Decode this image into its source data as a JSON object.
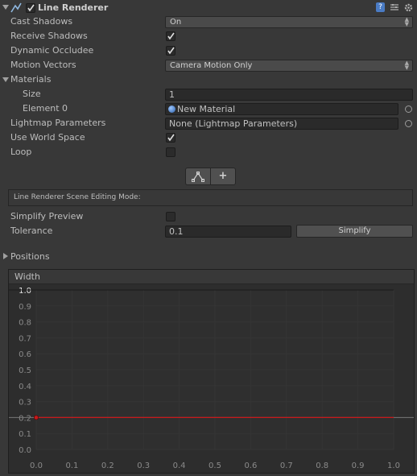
{
  "header": {
    "title": "Line Renderer",
    "icons": [
      "line-renderer-icon",
      "enable-checkbox",
      "help-icon",
      "preset-icon",
      "gear-icon"
    ]
  },
  "properties": {
    "cast_shadows": {
      "label": "Cast Shadows",
      "value": "On"
    },
    "receive_shadows": {
      "label": "Receive Shadows",
      "checked": true
    },
    "dynamic_occludee": {
      "label": "Dynamic Occludee",
      "checked": true
    },
    "motion_vectors": {
      "label": "Motion Vectors",
      "value": "Camera Motion Only"
    },
    "materials": {
      "label": "Materials",
      "size_label": "Size",
      "size_value": "1",
      "element0_label": "Element 0",
      "element0_value": "New Material"
    },
    "lightmap_parameters": {
      "label": "Lightmap Parameters",
      "value": "None (Lightmap Parameters)"
    },
    "use_world_space": {
      "label": "Use World Space",
      "checked": true
    },
    "loop": {
      "label": "Loop",
      "checked": false
    }
  },
  "edit_modes": {
    "edit_points_icon": "edit-points-icon",
    "create_points_label": "+"
  },
  "scene_editing": {
    "label": "Line Renderer Scene Editing Mode:"
  },
  "simplify": {
    "preview_label": "Simplify Preview",
    "preview_checked": false,
    "tolerance_label": "Tolerance",
    "tolerance_value": "0.1",
    "button_label": "Simplify"
  },
  "positions": {
    "label": "Positions"
  },
  "colors": {
    "background": "#383838",
    "field": "#2a2a2a",
    "curve": "#c8191b"
  },
  "chart_data": {
    "type": "line",
    "title": "Width",
    "xlabel": "",
    "ylabel": "",
    "x_ticks": [
      "0.0",
      "0.1",
      "0.2",
      "0.3",
      "0.4",
      "0.5",
      "0.6",
      "0.7",
      "0.8",
      "0.9",
      "1.0"
    ],
    "y_ticks": [
      "0.0",
      "0.1",
      "0.2",
      "0.3",
      "0.4",
      "0.5",
      "0.6",
      "0.7",
      "0.8",
      "0.9",
      "1.0"
    ],
    "xlim": [
      0,
      1
    ],
    "ylim": [
      0,
      1
    ],
    "grid": true,
    "series": [
      {
        "values": [
          0.2,
          0.2
        ],
        "x": [
          0,
          1
        ],
        "color": "#c8191b"
      }
    ],
    "keys": [
      {
        "x": 0,
        "y": 0.2
      }
    ]
  }
}
